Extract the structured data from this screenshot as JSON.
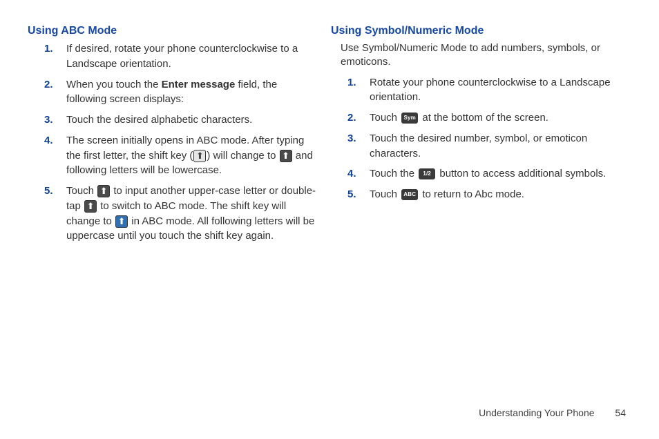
{
  "left": {
    "heading": "Using ABC Mode",
    "items": [
      {
        "num": "1.",
        "html": "If desired, rotate your phone counterclockwise to a Landscape orientation."
      },
      {
        "num": "2.",
        "html": "When you touch the <strong>Enter message</strong> field, the following screen displays:"
      },
      {
        "num": "3.",
        "html": "Touch the desired alphabetic characters."
      },
      {
        "num": "4.",
        "html": "The screen initially opens in ABC mode. After typing the first letter, the shift key (<span class=\"key key-light\" data-name=\"shift-key-light-icon\" data-interactable=\"false\"><span class=\"arrow\">⬆</span></span>) will change to <span class=\"key key-dark\" data-name=\"shift-key-dark-icon\" data-interactable=\"false\"><span class=\"arrow\">⬆</span></span> and following letters will be lowercase."
      },
      {
        "num": "5.",
        "html": "Touch <span class=\"key key-dark\" data-name=\"shift-key-dark-icon\" data-interactable=\"false\"><span class=\"arrow\">⬆</span></span> to input another upper-case letter or double-tap <span class=\"key key-dark\" data-name=\"shift-key-dark-icon\" data-interactable=\"false\"><span class=\"arrow\">⬆</span></span> to switch to ABC mode. The shift key will change to <span class=\"key key-blue\" data-name=\"shift-key-blue-icon\" data-interactable=\"false\"><span class=\"arrow\">⬆</span></span> in ABC mode. All following letters will be uppercase until you touch the shift key again."
      }
    ]
  },
  "right": {
    "heading": "Using Symbol/Numeric Mode",
    "intro": "Use Symbol/Numeric Mode to add numbers, symbols, or emoticons.",
    "items": [
      {
        "num": "1.",
        "html": "Rotate your phone counterclockwise to a Landscape orientation."
      },
      {
        "num": "2.",
        "html": "Touch <span class=\"badge\" data-name=\"sym-key-icon\" data-interactable=\"false\">Sym</span> at the bottom of the screen."
      },
      {
        "num": "3.",
        "html": "Touch the desired number, symbol, or emoticon characters."
      },
      {
        "num": "4.",
        "html": "Touch the <span class=\"badge\" data-name=\"page-1-2-key-icon\" data-interactable=\"false\">1/2</span> button to access additional symbols."
      },
      {
        "num": "5.",
        "html": "Touch <span class=\"badge\" data-name=\"abc-key-icon\" data-interactable=\"false\">ABC</span> to return to Abc mode."
      }
    ]
  },
  "footer": {
    "section": "Understanding Your Phone",
    "page": "54"
  }
}
